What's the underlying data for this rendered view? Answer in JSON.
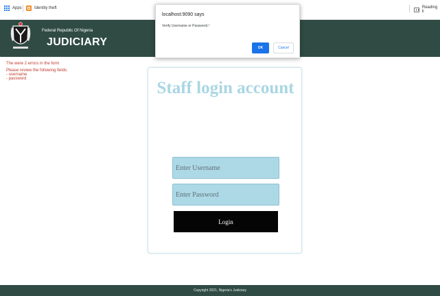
{
  "bookmarks_bar": {
    "apps_label": "Apps",
    "identity_theft_label": "Identity theft",
    "reading_list_label": "Reading li"
  },
  "header": {
    "republic_text": "Federal Republic Of Nigeria",
    "title": "JUDICIARY",
    "background_color": "#2f4b44"
  },
  "errors": {
    "title": "The were 2 errors in the form",
    "review_text": "Please review the following fields:",
    "fields": [
      "- username",
      "- password"
    ],
    "color": "#c0392b"
  },
  "login_card": {
    "title": "Staff login account",
    "username_placeholder": "Enter Username",
    "password_placeholder": "Enter Password",
    "login_label": "Login"
  },
  "footer": {
    "copyright": "Copyright 2021, Nigeria's Judiciary"
  },
  "dialog": {
    "title": "localhost:9090 says",
    "message": "Verify Username or Password.!",
    "ok_label": "OK",
    "cancel_label": "Cancel"
  }
}
